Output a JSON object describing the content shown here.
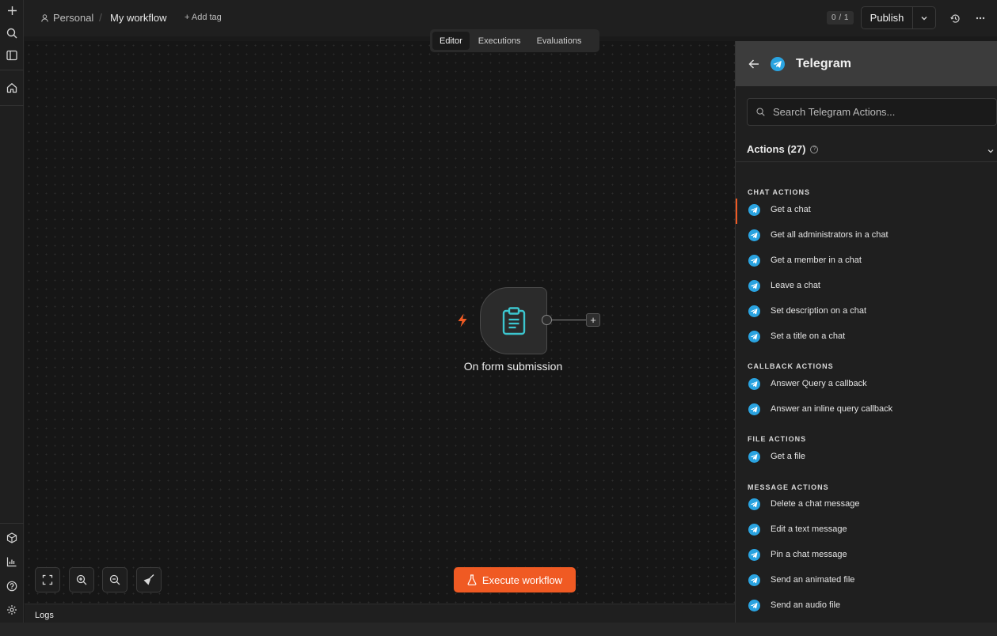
{
  "header": {
    "project": "Personal",
    "workflow_name": "My workflow",
    "add_tag": "+ Add tag",
    "counter": "0 / 1",
    "publish_label": "Publish"
  },
  "tabs": [
    {
      "label": "Editor",
      "active": true
    },
    {
      "label": "Executions",
      "active": false
    },
    {
      "label": "Evaluations",
      "active": false
    }
  ],
  "canvas": {
    "node_label": "On form submission",
    "execute_label": "Execute workflow",
    "logs_label": "Logs"
  },
  "panel": {
    "title": "Telegram",
    "search_placeholder": "Search Telegram Actions...",
    "actions_title": "Actions (27)",
    "sections": [
      {
        "label": "CHAT ACTIONS",
        "items": [
          "Get a chat",
          "Get all administrators in a chat",
          "Get a member in a chat",
          "Leave a chat",
          "Set description on a chat",
          "Set a title on a chat"
        ]
      },
      {
        "label": "CALLBACK ACTIONS",
        "items": [
          "Answer Query a callback",
          "Answer an inline query callback"
        ]
      },
      {
        "label": "FILE ACTIONS",
        "items": [
          "Get a file"
        ]
      },
      {
        "label": "MESSAGE ACTIONS",
        "items": [
          "Delete a chat message",
          "Edit a text message",
          "Pin a chat message",
          "Send an animated file",
          "Send an audio file"
        ]
      }
    ]
  },
  "colors": {
    "accent": "#f05a23",
    "telegram": "#2aa3e0",
    "node_icon": "#3cc6cf"
  },
  "icons": {
    "rail_top": [
      "plus-icon",
      "search-icon",
      "sidebar-toggle-icon",
      "home-icon"
    ],
    "rail_bottom": [
      "templates-icon",
      "insights-icon",
      "help-icon",
      "settings-icon"
    ]
  }
}
